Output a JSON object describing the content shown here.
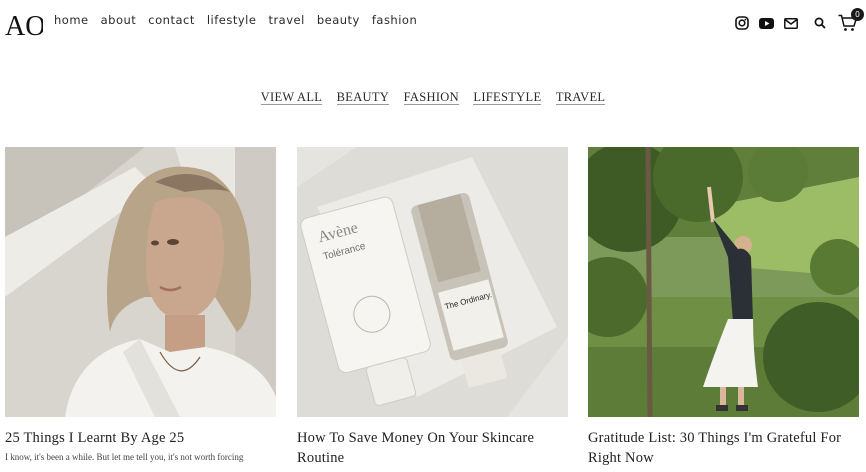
{
  "logo": {
    "text": "AO"
  },
  "nav": {
    "items": [
      "home",
      "about",
      "contact",
      "lifestyle",
      "travel",
      "beauty",
      "fashion"
    ]
  },
  "header_icons": [
    "instagram-icon",
    "youtube-icon",
    "mail-icon",
    "search-icon",
    "cart-icon"
  ],
  "cart": {
    "count": "0"
  },
  "filters": [
    "VIEW ALL",
    "BEAUTY",
    "FASHION",
    "LIFESTYLE",
    "TRAVEL"
  ],
  "posts": [
    {
      "title": "25 Things I Learnt By Age 25",
      "excerpt": "I know, it's been a while. But let me tell you, it's not worth forcing"
    },
    {
      "title": "How To Save Money On Your Skincare Routine",
      "excerpt": ""
    },
    {
      "title": "Gratitude List: 30 Things I'm Grateful For Right Now",
      "excerpt": ""
    }
  ],
  "products": {
    "avene_brand": "Avène",
    "avene_line": "Tolérance",
    "ordinary_brand": "The Ordinary."
  },
  "colors": {
    "text": "#1a1a1a",
    "underline": "#999999",
    "background": "#ffffff"
  }
}
